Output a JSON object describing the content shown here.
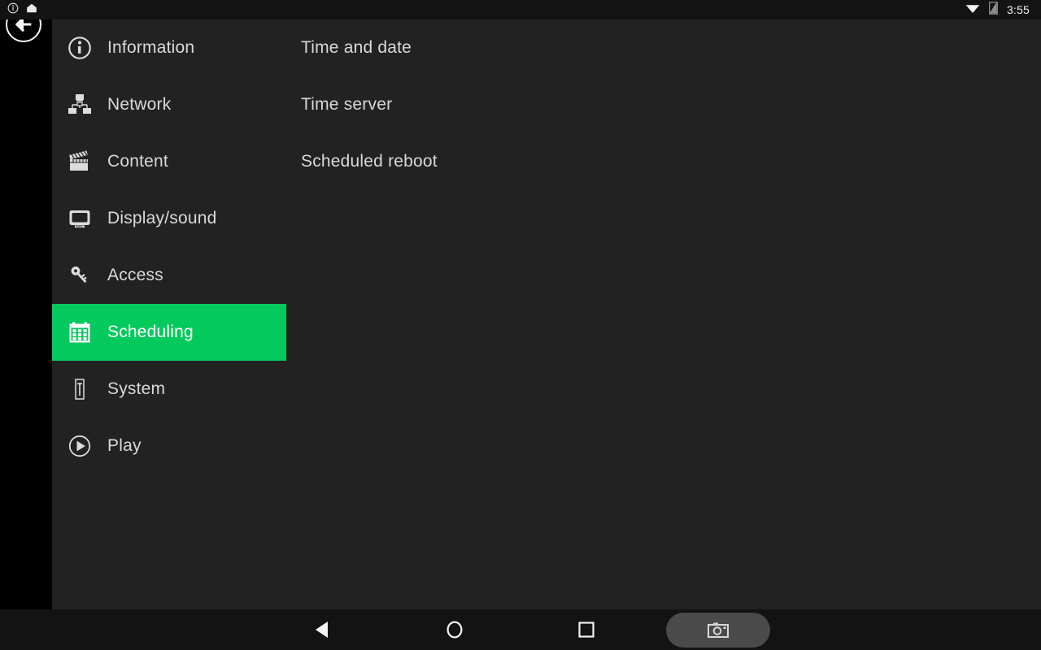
{
  "statusbar": {
    "left_icons": [
      "info-circle-icon",
      "home-upload-icon"
    ],
    "right_icons": [
      "wifi-icon",
      "signal-off-icon"
    ],
    "clock": "3:55"
  },
  "navigation": {
    "back_button": "back-arrow-button"
  },
  "accent_color": "#04C95C",
  "sidebar": {
    "items": [
      {
        "label": "Information",
        "icon": "info-circle-icon",
        "selected": false
      },
      {
        "label": "Network",
        "icon": "network-icon",
        "selected": false
      },
      {
        "label": "Content",
        "icon": "clapperboard-icon",
        "selected": false
      },
      {
        "label": "Display/sound",
        "icon": "monitor-icon",
        "selected": false
      },
      {
        "label": "Access",
        "icon": "key-icon",
        "selected": false
      },
      {
        "label": "Scheduling",
        "icon": "calendar-icon",
        "selected": true
      },
      {
        "label": "System",
        "icon": "device-tower-icon",
        "selected": false
      },
      {
        "label": "Play",
        "icon": "play-circle-icon",
        "selected": false
      }
    ]
  },
  "main": {
    "settings": [
      {
        "label": "Time and date"
      },
      {
        "label": "Time server"
      },
      {
        "label": "Scheduled reboot"
      }
    ]
  },
  "navbar": {
    "buttons": [
      {
        "name": "back",
        "icon": "triangle-left-icon"
      },
      {
        "name": "home",
        "icon": "circle-icon"
      },
      {
        "name": "recents",
        "icon": "square-icon"
      },
      {
        "name": "screenshot",
        "icon": "camera-icon"
      }
    ]
  }
}
